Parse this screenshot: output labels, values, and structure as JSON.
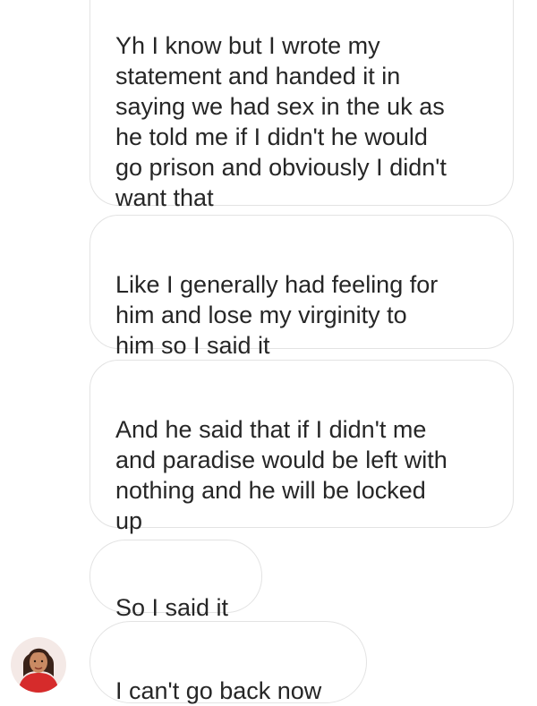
{
  "conversation": {
    "messages": [
      {
        "text": "Yh I know but I wrote my\nstatement and handed it in\nsaying we had sex in the uk as\nhe told me if I didn't he would\ngo prison and obviously I didn't\nwant that"
      },
      {
        "text": "Like I generally had feeling for\nhim and lose my virginity to\nhim so I said it"
      },
      {
        "text": "And he said that if I didn't me\nand paradise would be left with\nnothing and he will be locked\nup"
      },
      {
        "text": "So I said it"
      },
      {
        "text": "I can't go back now"
      }
    ]
  },
  "colors": {
    "bubble_border": "#e3e3e3",
    "text": "#262626",
    "background": "#ffffff"
  },
  "icons": {
    "sender_avatar": "profile-avatar-icon"
  }
}
